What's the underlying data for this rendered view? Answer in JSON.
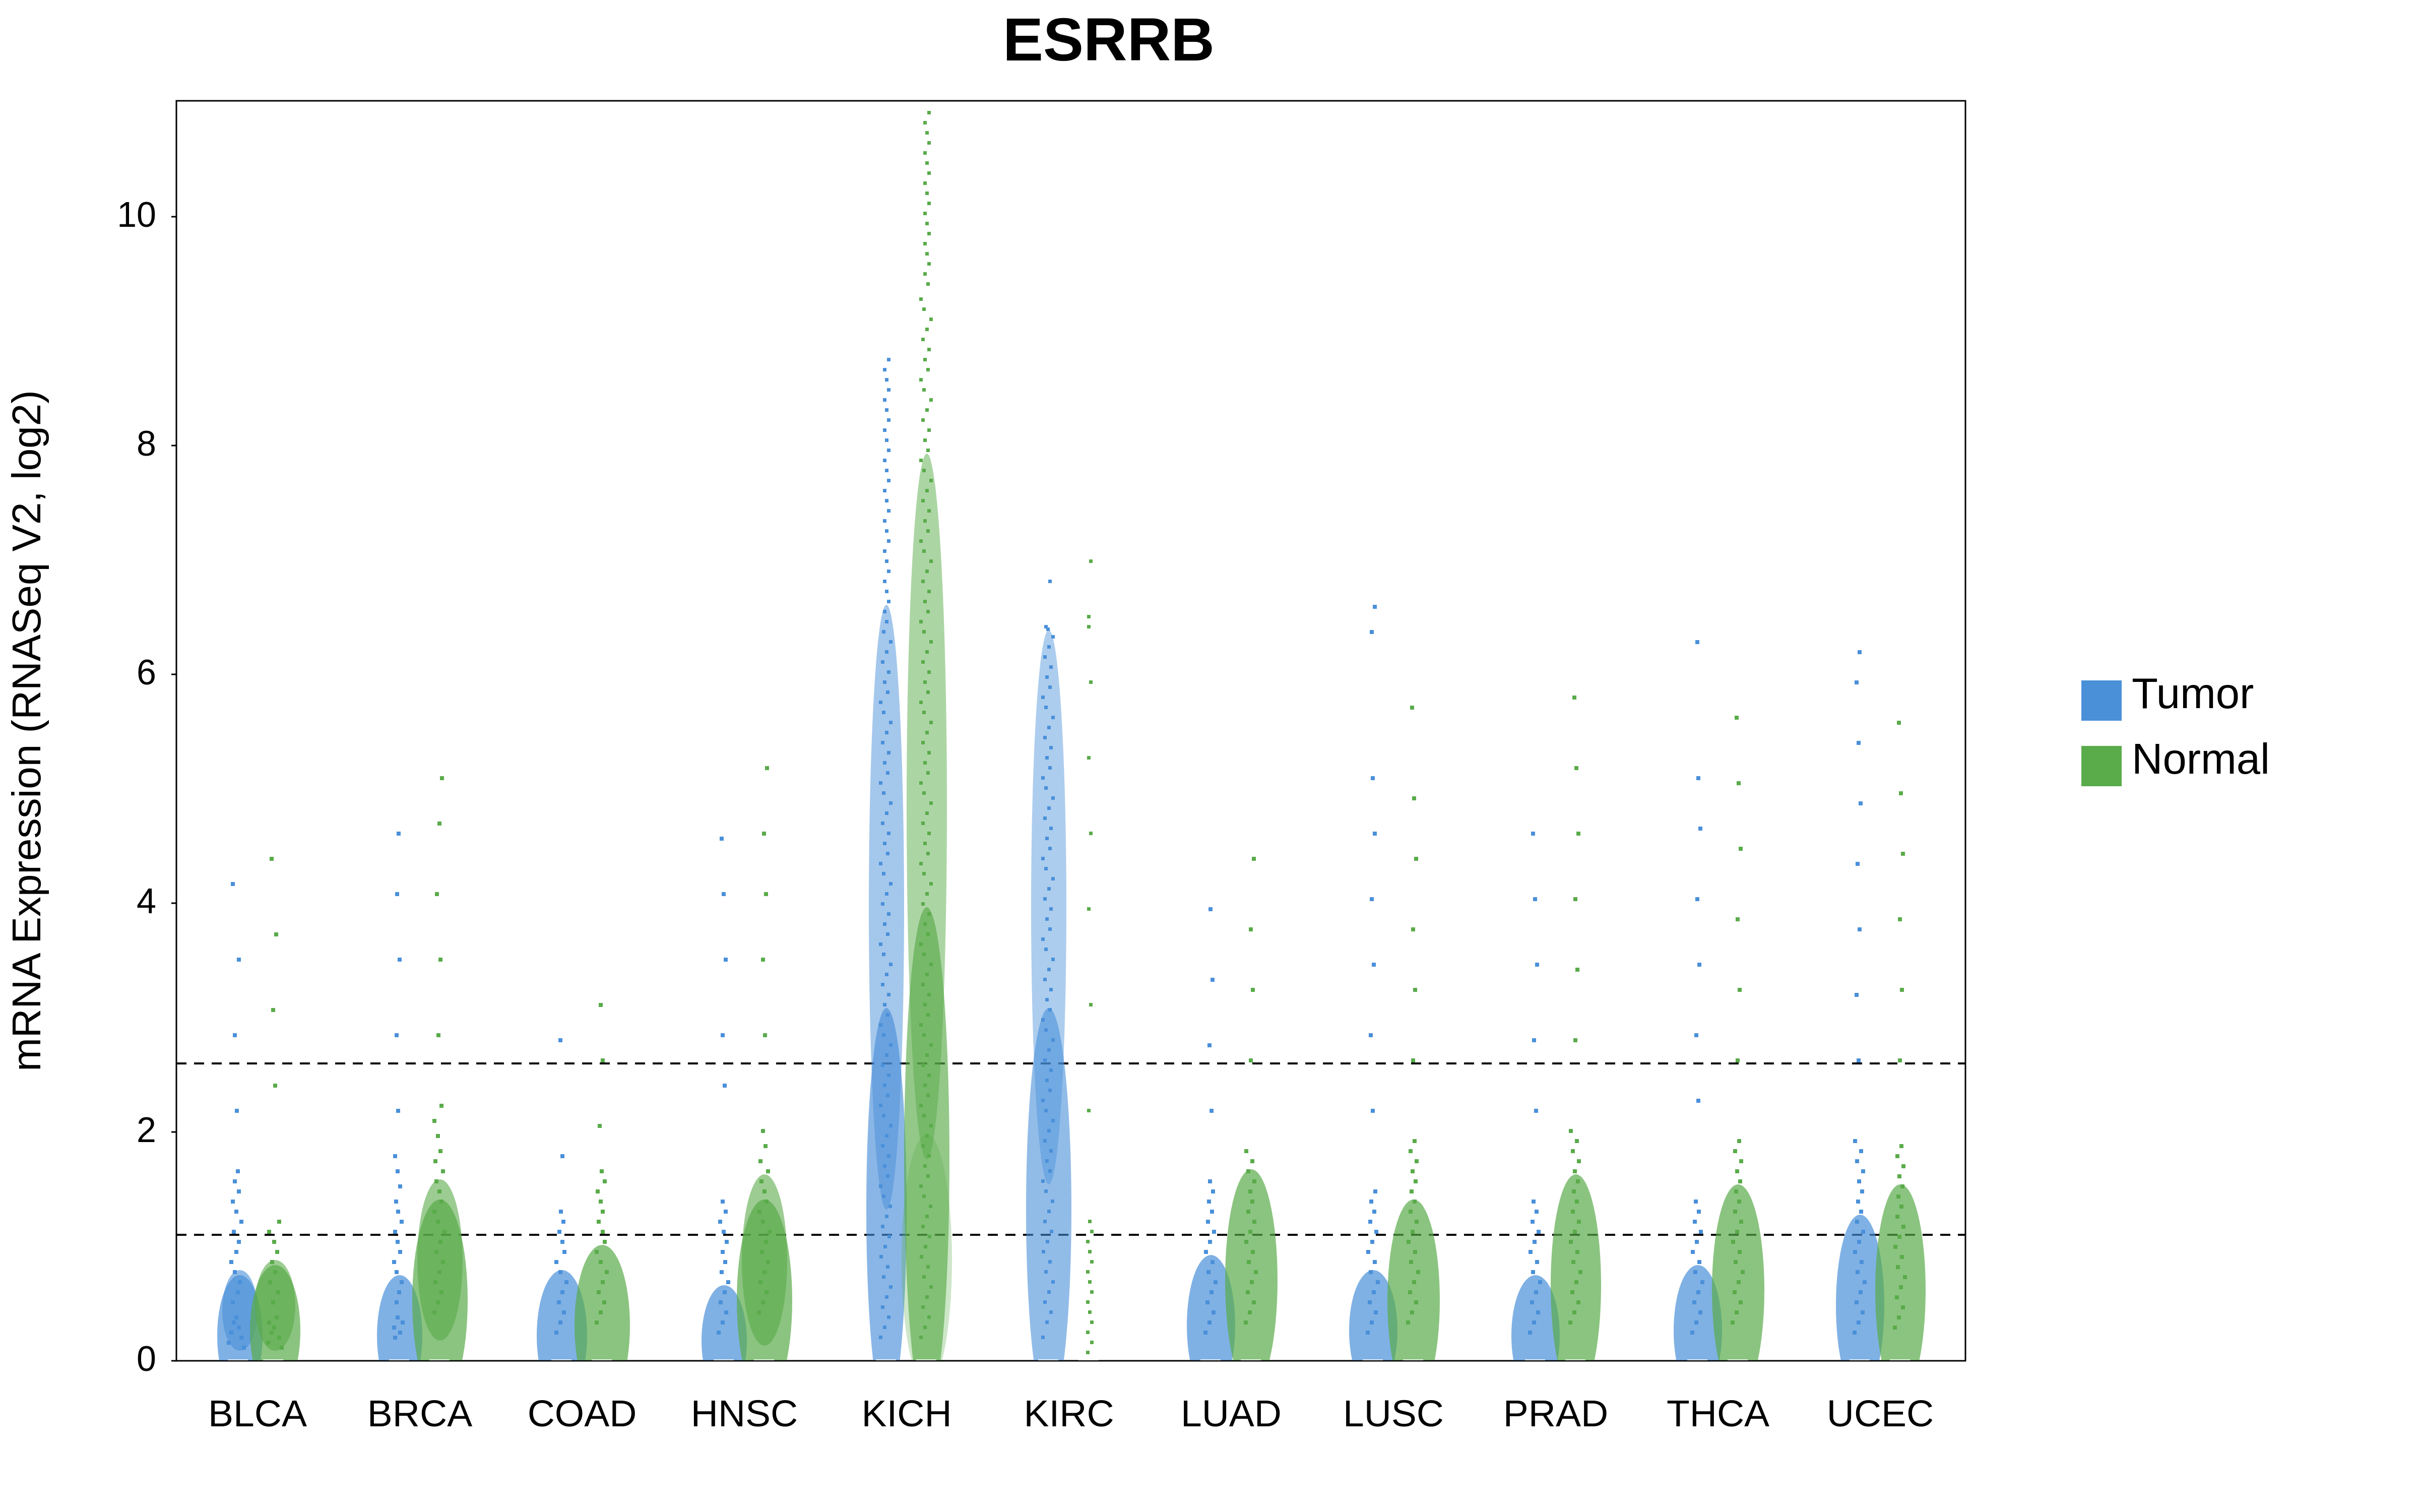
{
  "title": "ESRRB",
  "yAxisLabel": "mRNA Expression (RNASeq V2, log2)",
  "xCategories": [
    "BLCA",
    "BRCA",
    "COAD",
    "HNSC",
    "KICH",
    "KIRC",
    "LUAD",
    "LUSC",
    "PRAD",
    "THCA",
    "UCEC"
  ],
  "yTicks": [
    0,
    2,
    4,
    6,
    8,
    10
  ],
  "legend": [
    {
      "label": "Tumor",
      "color": "#4a90d9"
    },
    {
      "label": "Normal",
      "color": "#5aab4a"
    }
  ],
  "dottedLines": [
    1.1,
    2.6
  ],
  "colors": {
    "tumor": "#4a90d9",
    "normal": "#5aab4a",
    "tumorLight": "#a8c8f0",
    "normalLight": "#a8d898"
  }
}
